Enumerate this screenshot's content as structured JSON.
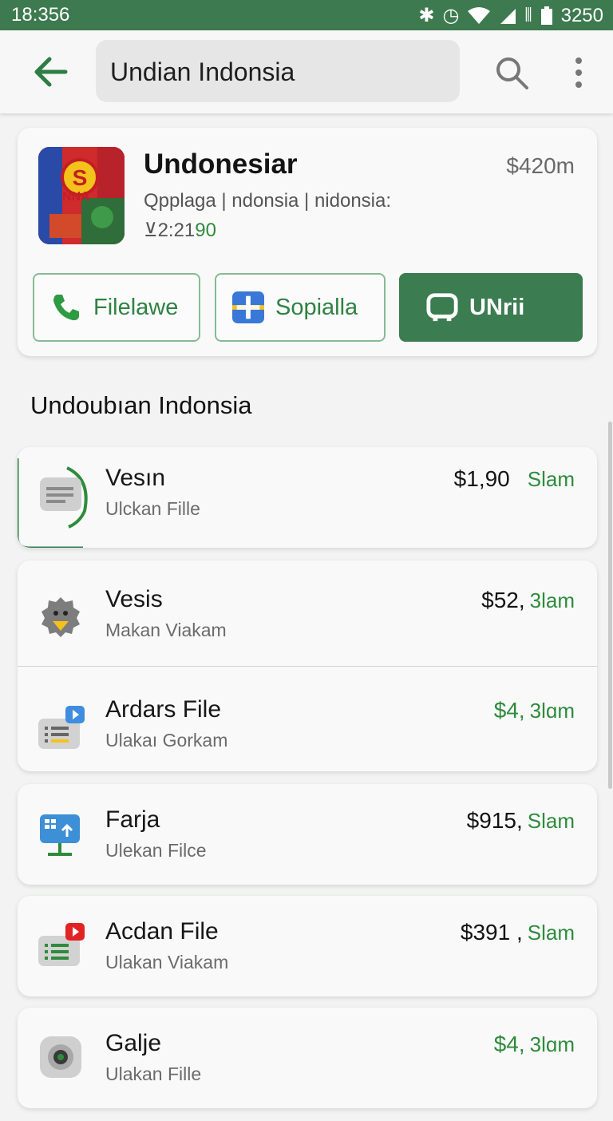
{
  "status": {
    "time": "18:356",
    "battery": "3250"
  },
  "search": {
    "query": "Undian Indonsia"
  },
  "app": {
    "name": "Undonesiar",
    "price": "$420m",
    "subtitle": "Qpplaga | ndonsia | nidonsia:",
    "rating_prefix": "⊻2:21",
    "rating_suffix": "90",
    "icon_text": "NNA"
  },
  "buttons": [
    {
      "label": "Filelawe"
    },
    {
      "label": "Sopialla"
    },
    {
      "label": "UNrii"
    }
  ],
  "section_title": "Undoubıan Indonsia",
  "list": [
    {
      "title": "Vesın",
      "subtitle": "Ulckan Fille",
      "price": "$1,90",
      "tag": "Slam",
      "price_green": false
    },
    {
      "title": "Vesis",
      "subtitle": "Makan Viakam",
      "price": "$52,",
      "tag": "3lam",
      "price_green": false
    },
    {
      "title": "Ardars File",
      "subtitle": "Ulakaı Gorkam",
      "price": "$4,",
      "tag": "3lɑm",
      "price_green": true
    },
    {
      "title": "Farja",
      "subtitle": "Ulekan Filсe",
      "price": "$915,",
      "tag": "Slam",
      "price_green": false
    },
    {
      "title": "Acdan File",
      "subtitle": "Ulakan Viakam",
      "price": "$391 ,",
      "tag": "Slam",
      "price_green": false
    },
    {
      "title": "Galje",
      "subtitle": "Ulakan Fille",
      "price": "$4,",
      "tag": "3lɑm",
      "price_green": true
    }
  ],
  "colors": {
    "status_bar": "#3e7a4f",
    "accent_green": "#2e8b3c",
    "primary_button": "#3b7c51"
  },
  "icons": [
    "back-arrow-icon",
    "search-icon",
    "more-vert-icon",
    "phone-icon",
    "plus-icon",
    "tv-icon",
    "document-icon",
    "gear-bird-icon",
    "list-play-icon",
    "monitor-upload-icon",
    "youtube-list-icon",
    "camera-lens-icon"
  ]
}
